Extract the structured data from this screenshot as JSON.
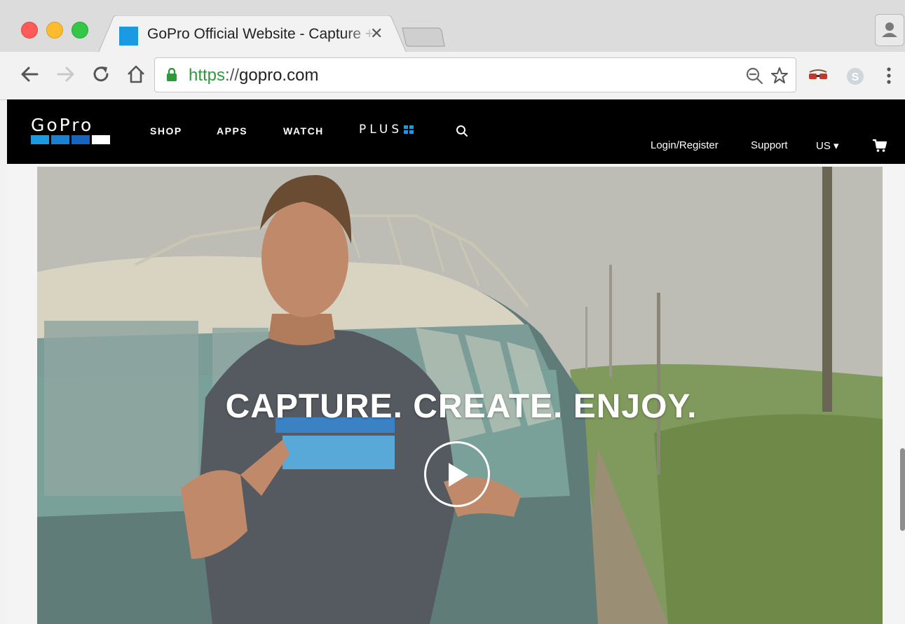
{
  "browser": {
    "tab": {
      "title": "GoPro Official Website - Capture + Share Your World",
      "close_glyph": "✕"
    },
    "address_bar": {
      "scheme": "https",
      "separator": "://",
      "host": "gopro.com"
    }
  },
  "site": {
    "logo_text": "GoPro",
    "nav": {
      "shop": "SHOP",
      "apps": "APPS",
      "watch": "WATCH",
      "plus": "PLUS",
      "login": "Login/Register",
      "support": "Support",
      "region": "US ▾"
    },
    "hero": {
      "headline": "CAPTURE. CREATE. ENJOY."
    }
  },
  "colors": {
    "brand_blue": "#1a9ae0",
    "nav_bg": "#000000",
    "secure_green": "#2d9a3a"
  },
  "icons": [
    "back-icon",
    "forward-icon",
    "reload-icon",
    "home-icon",
    "lock-icon",
    "zoom-icon",
    "star-icon",
    "extension-icon",
    "skype-icon",
    "menu-icon",
    "search-icon",
    "cart-icon",
    "play-icon",
    "profile-icon"
  ]
}
